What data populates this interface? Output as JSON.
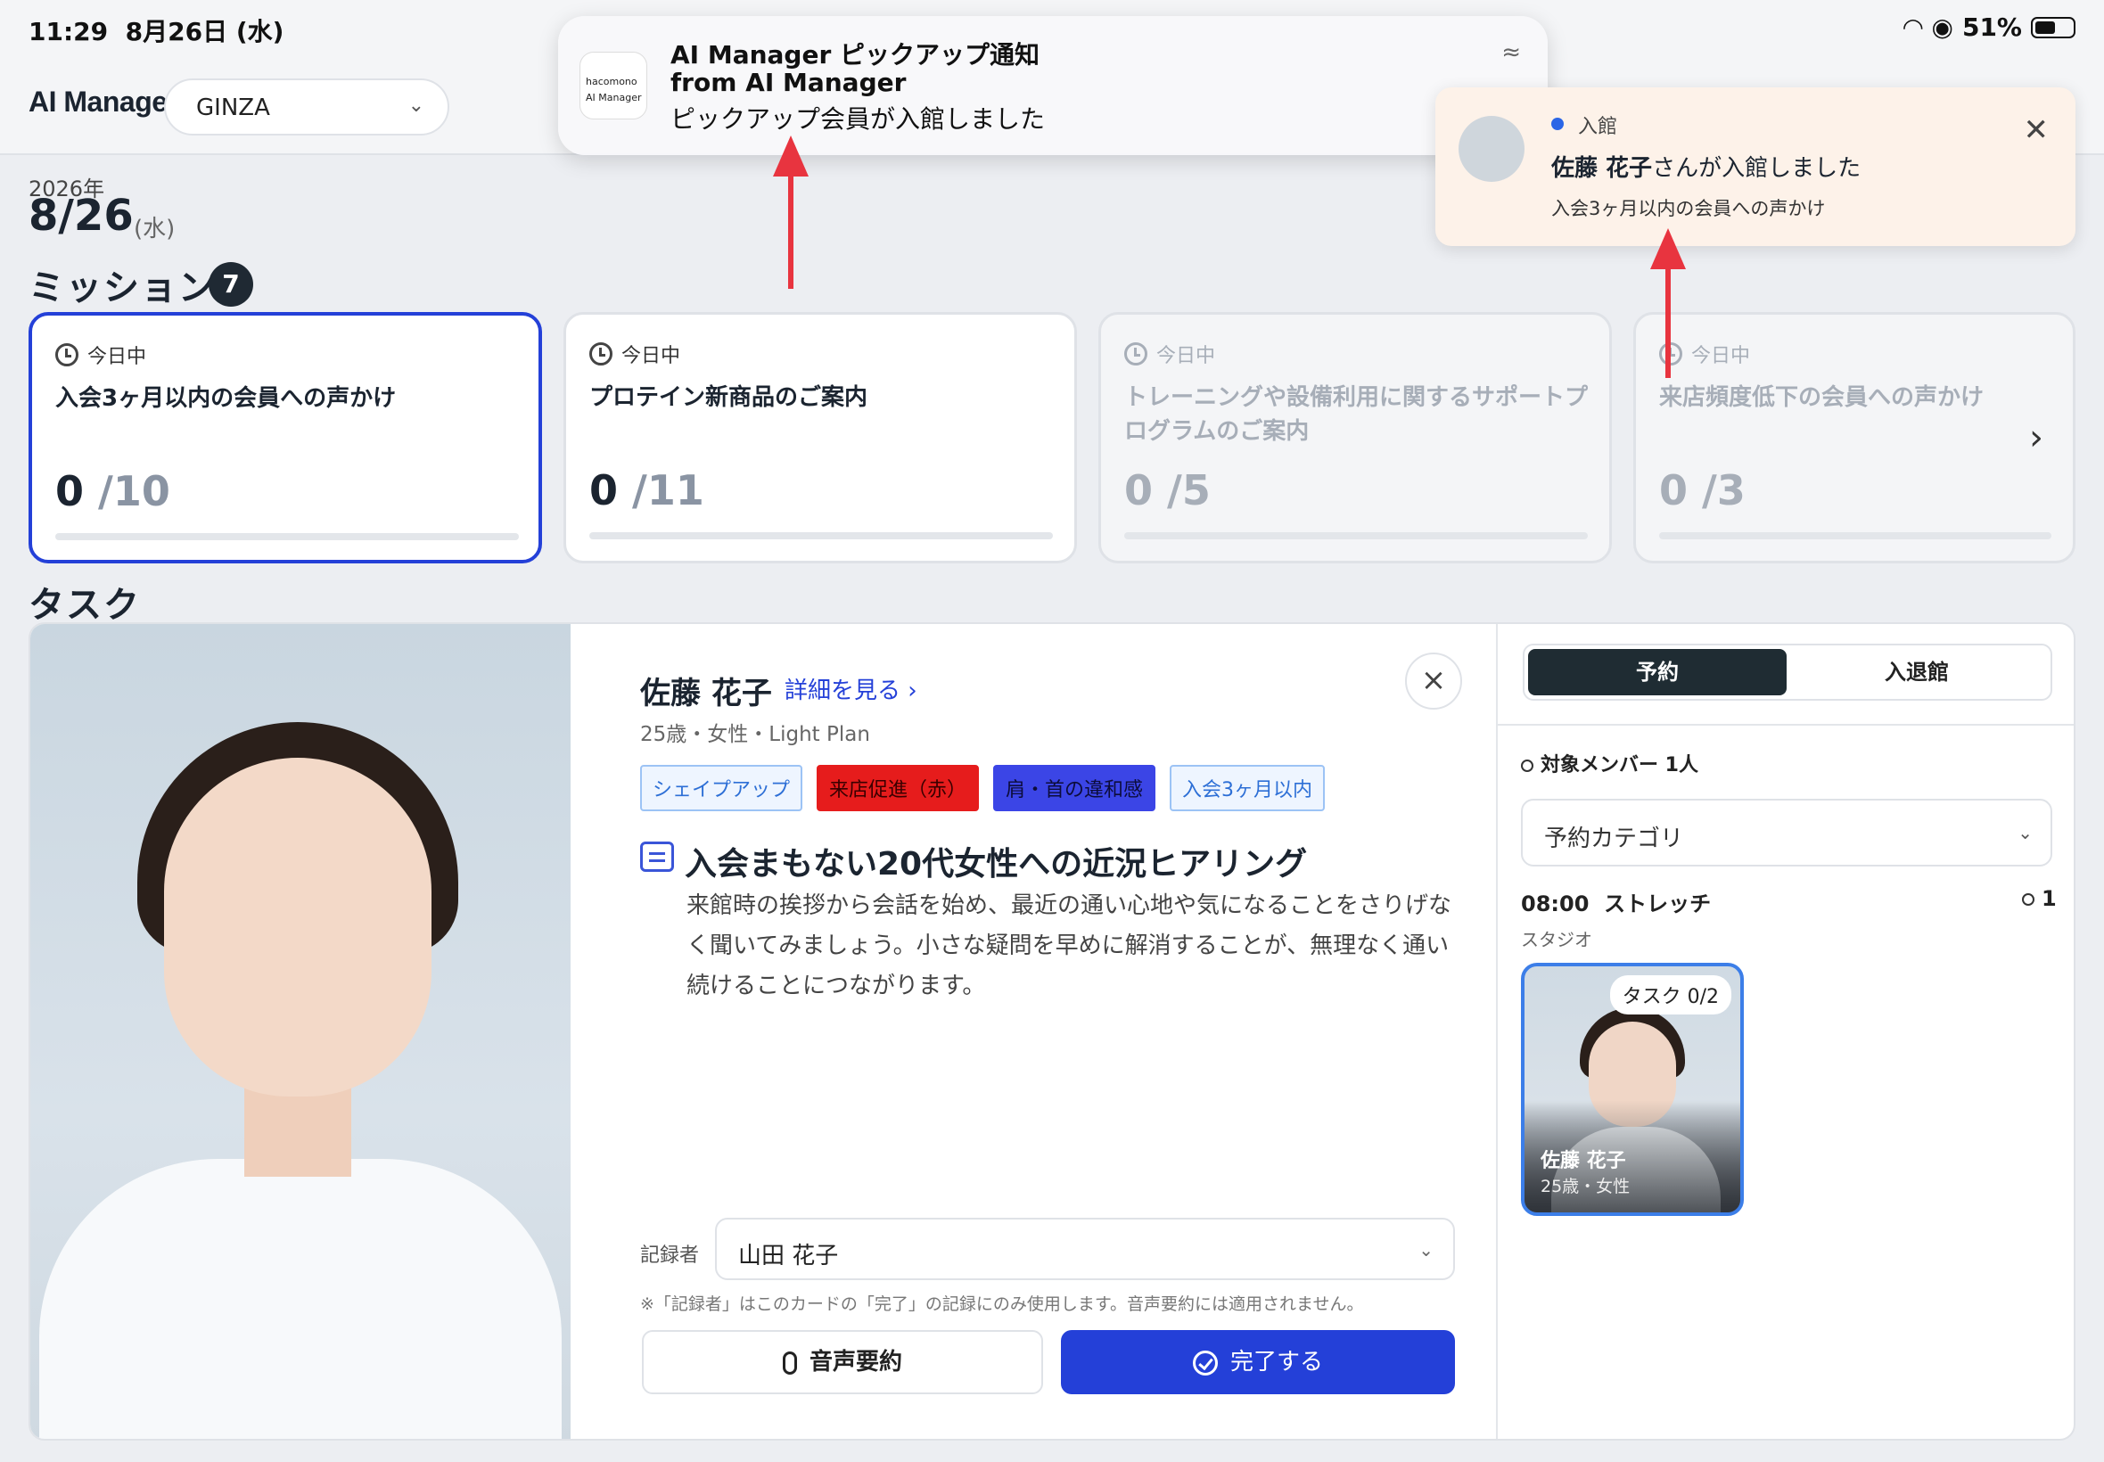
{
  "status_bar": {
    "time": "11:29",
    "date": "8月26日 (水)",
    "battery": "51%"
  },
  "header": {
    "app_title": "AI Manager",
    "store": "GINZA"
  },
  "date": {
    "year": "2026年",
    "day": "8/26",
    "dow": "(水)"
  },
  "missions": {
    "title": "ミッション",
    "count": "7",
    "cards": [
      {
        "when": "今日中",
        "title": "入会3ヶ月以内の会員への声かけ",
        "done": "0",
        "total": "/10",
        "state": "active"
      },
      {
        "when": "今日中",
        "title": "プロテイン新商品のご案内",
        "done": "0",
        "total": "/11",
        "state": "normal"
      },
      {
        "when": "今日中",
        "title": "トレーニングや設備利用に関するサポートプログラムのご案内",
        "done": "0",
        "total": "/5",
        "state": "dim"
      },
      {
        "when": "今日中",
        "title": "来店頻度低下の会員への声かけ",
        "done": "0",
        "total": "/3",
        "state": "dim"
      }
    ]
  },
  "task": {
    "title": "タスク",
    "member": {
      "name": "佐藤 花子",
      "detail_link": "詳細を見る",
      "meta": "25歳・女性・Light Plan"
    },
    "tags": [
      {
        "label": "シェイプアップ",
        "fg": "#2d6fd6",
        "bg": "#eef5ff",
        "border": "#9cc3f5"
      },
      {
        "label": "来店促進（赤）",
        "fg": "#3a0000",
        "bg": "#e61c1c",
        "border": "#e61c1c"
      },
      {
        "label": "肩・首の違和感",
        "fg": "#0c0c3a",
        "bg": "#3b45e6",
        "border": "#3b45e6"
      },
      {
        "label": "入会3ヶ月以内",
        "fg": "#2d6fd6",
        "bg": "#eef5ff",
        "border": "#9cc3f5"
      }
    ],
    "ai_title": "入会まもない20代女性への近況ヒアリング",
    "ai_body": "来館時の挨拶から会話を始め、最近の通い心地や気になることをさりげなく聞いてみましょう。小さな疑問を早めに解消することが、無理なく通い続けることにつながります。",
    "recorder_label": "記録者",
    "recorder_value": "山田 花子",
    "recorder_note": "※「記録者」はこのカードの「完了」の記録にのみ使用します。音声要約には適用されません。",
    "voice_button": "音声要約",
    "done_button": "完了する"
  },
  "side": {
    "tab_reserve": "予約",
    "tab_checkin": "入退館",
    "target_label": "対象メンバー 1人",
    "category_placeholder": "予約カテゴリ",
    "schedule_time": "08:00",
    "schedule_name": "ストレッチ",
    "schedule_count": "1",
    "schedule_place": "スタジオ",
    "member_card": {
      "task": "タスク 0/2",
      "name": "佐藤 花子",
      "meta": "25歳・女性"
    }
  },
  "notifications": {
    "ios": {
      "app_icon_line1": "hacomono",
      "app_icon_line2": "AI Manager",
      "title": "AI Manager ピックアップ通知",
      "from": "from AI Manager",
      "body": "ピックアップ会員が入館しました"
    },
    "app": {
      "type": "入館",
      "name": "佐藤 花子",
      "message_suffix": "さんが入館しました",
      "sub": "入会3ヶ月以内の会員への声かけ"
    }
  }
}
